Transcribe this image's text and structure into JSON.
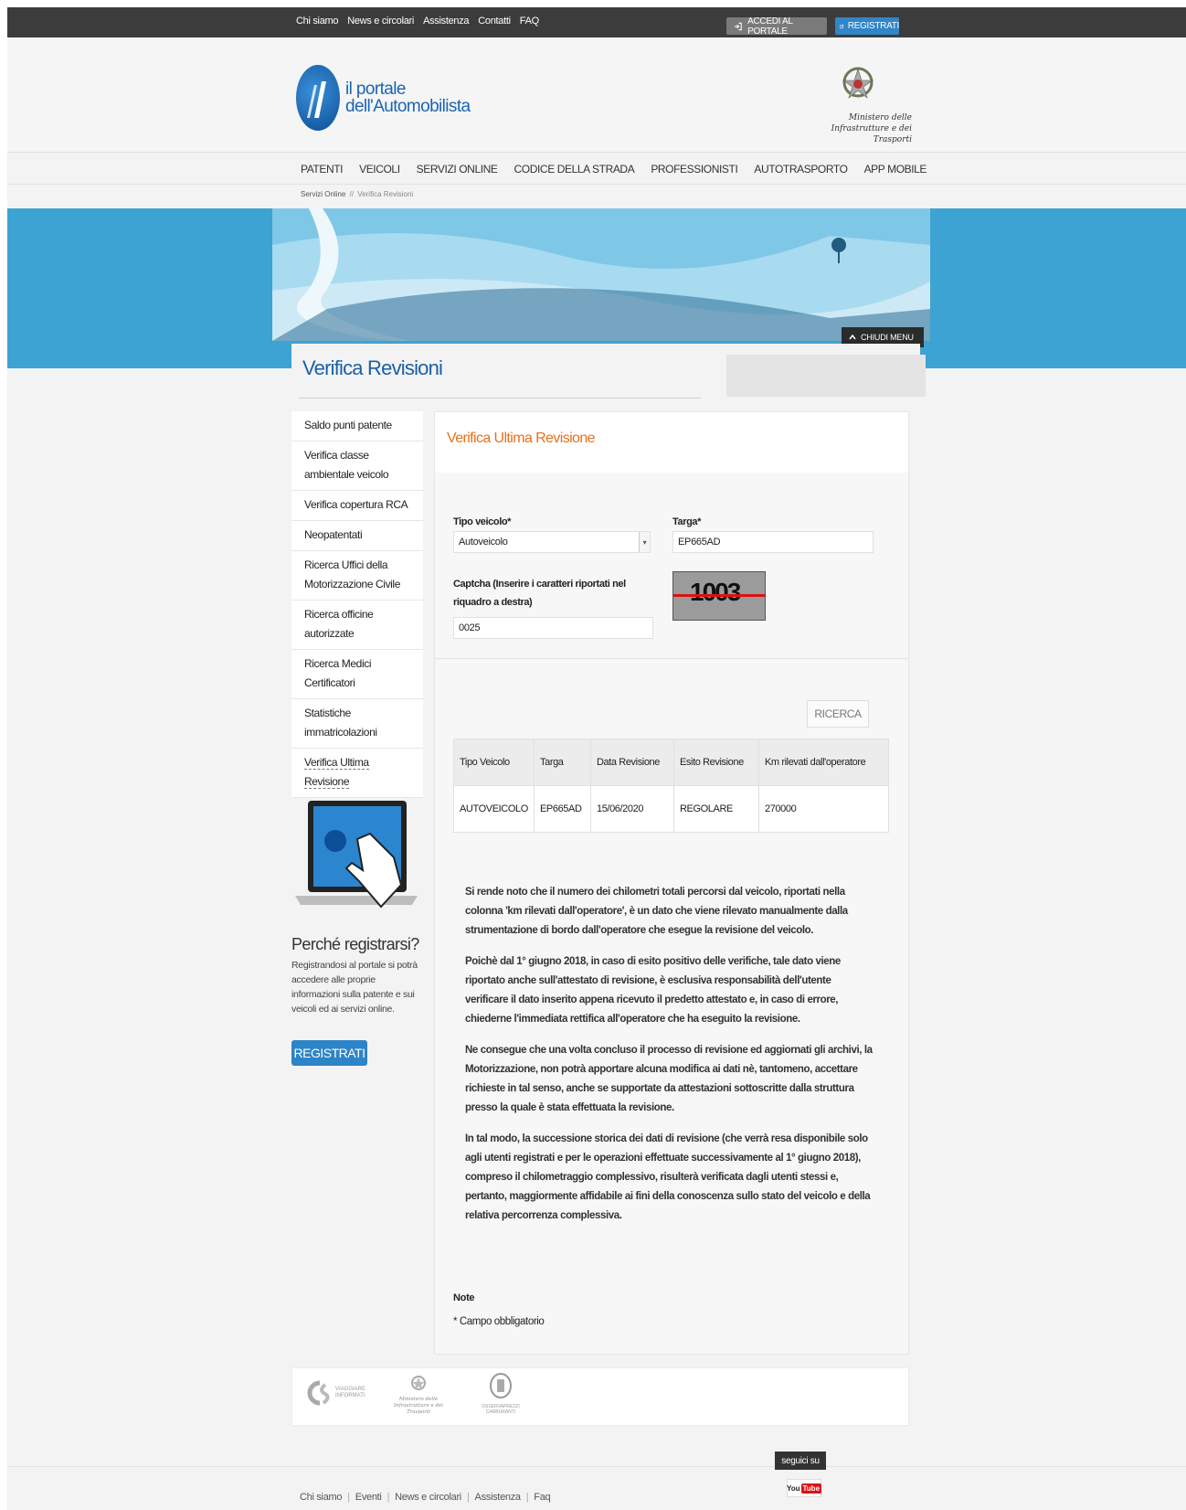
{
  "topbar": {
    "links": [
      "Chi siamo",
      "News e circolari",
      "Assistenza",
      "Contatti",
      "FAQ"
    ],
    "login_label": "ACCEDI AL PORTALE",
    "register_label": "REGISTRATI"
  },
  "header": {
    "logo_line1": "il portale",
    "logo_line2": "dell'Automobilista",
    "ministry_line1": "Ministero delle",
    "ministry_line2": "Infrastrutture e dei Trasporti"
  },
  "nav": [
    "PATENTI",
    "VEICOLI",
    "SERVIZI ONLINE",
    "CODICE DELLA STRADA",
    "PROFESSIONISTI",
    "AUTOTRASPORTO",
    "APP MOBILE"
  ],
  "breadcrumb": {
    "root": "Servizi Online",
    "sep": "//",
    "current": "Verifica Revisioni"
  },
  "banner": {
    "close_menu": "CHIUDI MENU"
  },
  "page_title": "Verifica Revisioni",
  "sidebar": {
    "items": [
      {
        "label": "Saldo punti patente"
      },
      {
        "label": "Verifica classe ambientale veicolo"
      },
      {
        "label": "Verifica copertura RCA"
      },
      {
        "label": "Neopatentati"
      },
      {
        "label": "Ricerca Uffici della Motorizzazione Civile"
      },
      {
        "label": "Ricerca officine autorizzate"
      },
      {
        "label": "Ricerca Medici Certificatori"
      },
      {
        "label": "Statistiche immatricolazioni"
      },
      {
        "label": "Verifica Ultima Revisione"
      }
    ],
    "why_title": "Perché registrarsi?",
    "why_text": "Registrandosi al portale si potrà accedere alle proprie informazioni sulla patente e sui veicoli ed ai servizi online.",
    "register_button": "REGISTRATI"
  },
  "panel": {
    "title": "Verifica Ultima Revisione",
    "tipo_label": "Tipo veicolo*",
    "tipo_value": "Autoveicolo",
    "targa_label": "Targa*",
    "targa_value": "EP665AD",
    "captcha_label": "Captcha (Inserire i caratteri riportati nel riquadro a destra)",
    "captcha_value": "0025",
    "captcha_image_text": "1003",
    "search_button": "RICERCA",
    "table": {
      "headers": [
        "Tipo Veicolo",
        "Targa",
        "Data Revisione",
        "Esito Revisione",
        "Km rilevati dall'operatore"
      ],
      "rows": [
        [
          "AUTOVEICOLO",
          "EP665AD",
          "15/06/2020",
          "REGOLARE",
          "270000"
        ]
      ]
    },
    "info": [
      "Si rende noto che il numero dei chilometri totali percorsi dal veicolo, riportati nella colonna 'km rilevati dall'operatore', è un dato che viene rilevato manualmente dalla strumentazione di bordo dall'operatore che esegue la revisione del veicolo.",
      "Poichè dal 1° giugno 2018, in caso di esito positivo delle verifiche, tale dato viene riportato anche sull'attestato di revisione, è esclusiva responsabilità dell'utente verificare il dato inserito appena ricevuto il predetto attestato e, in caso di errore, chiederne l'immediata rettifica all'operatore che ha eseguito la revisione.",
      "Ne consegue che una volta concluso il processo di revisione ed aggiornati gli archivi, la Motorizzazione, non potrà apportare alcuna modifica ai dati nè, tantomeno, accettare richieste in tal senso, anche se supportate da attestazioni sottoscritte dalla struttura presso la quale è stata effettuata la revisione.",
      "In tal modo, la successione storica dei dati di revisione (che verrà resa disponibile solo agli utenti registrati e per le operazioni effettuate successivamente al 1° giugno 2018), compreso il chilometraggio complessivo, risulterà verificata dagli utenti stessi e, pertanto, maggiormente affidabile ai fini della conoscenza sullo stato del veicolo e della relativa percorrenza complessiva."
    ],
    "note_title": "Note",
    "note_text": "* Campo obbligatorio"
  },
  "partners": {
    "p1_line1": "VIAGGIARE",
    "p1_line2": "INFORMATI",
    "p2_line1": "Ministero delle",
    "p2_line2": "Infrastrutture e dei Trasporti",
    "p3_line1": "OSSERVAPREZZI",
    "p3_line2": "CARBURANTI"
  },
  "footer": {
    "follow": "seguici su",
    "yt_you": "You",
    "yt_tube": "Tube",
    "links": [
      "Chi siamo",
      "Eventi",
      "News e circolari",
      "Assistenza",
      "Faq"
    ]
  },
  "colors": {
    "accent_blue": "#1a5fa8",
    "orange_title": "#e8711c",
    "topbar": "#3c3c3c",
    "banner": "#3da3d2"
  }
}
